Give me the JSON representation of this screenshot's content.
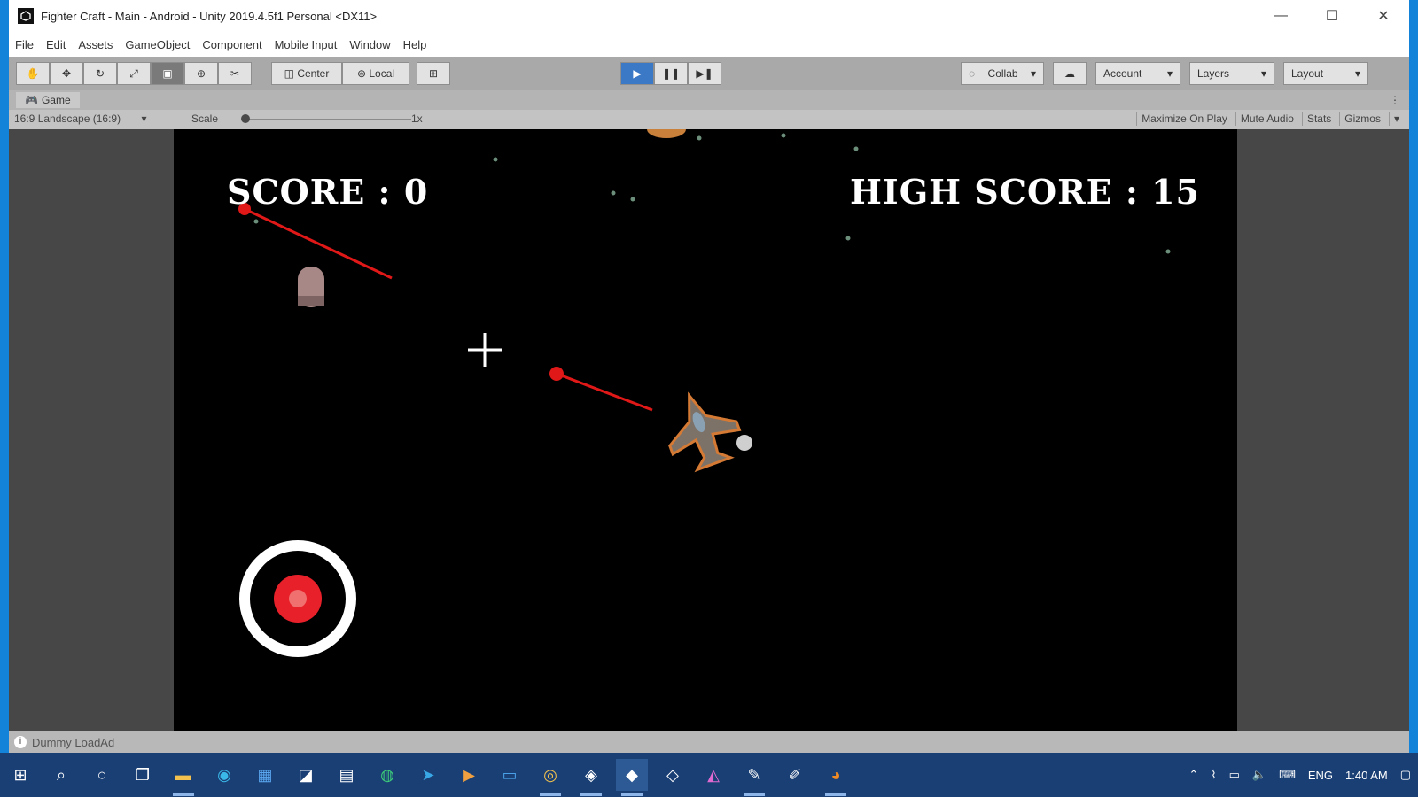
{
  "window": {
    "title": "Fighter Craft - Main - Android - Unity 2019.4.5f1 Personal <DX11>",
    "controls": {
      "minimize": "—",
      "maximize": "☐",
      "close": "✕"
    }
  },
  "menu": [
    "File",
    "Edit",
    "Assets",
    "GameObject",
    "Component",
    "Mobile Input",
    "Window",
    "Help"
  ],
  "toolbar": {
    "pivot_label": "Center",
    "space_label": "Local",
    "collab_label": "Collab",
    "account_label": "Account",
    "layers_label": "Layers",
    "layout_label": "Layout",
    "play_icon": "play-icon",
    "pause_icon": "pause-icon",
    "step_icon": "step-icon"
  },
  "game_panel": {
    "tab_label": "Game",
    "resolution": "16:9 Landscape (16:9)",
    "scale_label": "Scale",
    "scale_value": "1x",
    "options": [
      "Maximize On Play",
      "Mute Audio",
      "Stats",
      "Gizmos"
    ]
  },
  "game": {
    "score_text": "SCORE : 0",
    "high_score_text": "HIGH SCORE : 15",
    "fire_button_icon": "target-icon",
    "colors": {
      "laser": "#e01818",
      "fire_button": "#e8202a",
      "ring": "#ffffff"
    }
  },
  "status": {
    "message": "Dummy LoadAd"
  },
  "taskbar": {
    "apps": [
      "windows-start-icon",
      "search-icon",
      "cortana-icon",
      "task-view-icon",
      "file-explorer-icon",
      "edge-icon",
      "store-icon",
      "shopping-bag-icon",
      "notepad-icon",
      "gitkraken-icon",
      "telegram-icon",
      "video-icon",
      "remote-desktop-icon",
      "chrome-icon",
      "unity-hub-icon",
      "unity-icon",
      "unity-dark-icon",
      "color-picker-icon",
      "paint-icon",
      "pen-icon",
      "blender-icon"
    ],
    "tray": {
      "language": "ENG",
      "time": "1:40 AM"
    }
  }
}
